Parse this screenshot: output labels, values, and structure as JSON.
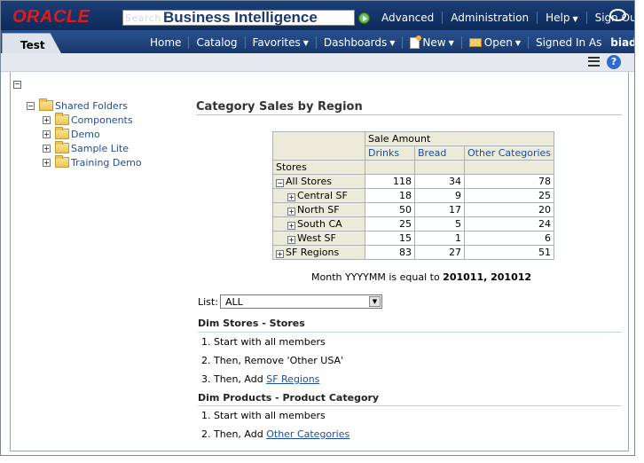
{
  "header": {
    "logo": "ORACLE",
    "search_label": "Search",
    "product_title": "Business Intelligence",
    "links": [
      {
        "label": "Advanced"
      },
      {
        "label": "Administration"
      },
      {
        "label": "Help",
        "dropdown": true
      },
      {
        "label": "Sign Out"
      }
    ]
  },
  "nav": {
    "active_tab": "Test",
    "links": [
      {
        "label": "Home"
      },
      {
        "label": "Catalog"
      },
      {
        "label": "Favorites",
        "dropdown": true
      },
      {
        "label": "Dashboards",
        "dropdown": true
      },
      {
        "label": "New",
        "dropdown": true
      },
      {
        "label": "Open",
        "dropdown": true
      }
    ],
    "signed_in_label": "Signed In As",
    "user": "biadmin"
  },
  "icons": {
    "go": "play-circle-icon",
    "chat": "chat-bubble-icon",
    "page_options": "list-icon",
    "help": "help-icon",
    "folder": "folder-icon"
  },
  "tree": {
    "collapse_symbol": "−",
    "root": "Shared Folders",
    "children": [
      "Components",
      "Demo",
      "Sample Lite",
      "Training Demo"
    ]
  },
  "report": {
    "title": "Category Sales by Region",
    "measure_header": "Sale Amount",
    "columns": [
      "Drinks",
      "Bread",
      "Other Categories"
    ],
    "row_header": "Stores",
    "rows": [
      {
        "label": "All Stores",
        "toggle": "−",
        "indent": false,
        "values": [
          "118",
          "34",
          "78"
        ]
      },
      {
        "label": "Central SF",
        "toggle": "+",
        "indent": true,
        "values": [
          "18",
          "9",
          "25"
        ]
      },
      {
        "label": "North SF",
        "toggle": "+",
        "indent": true,
        "values": [
          "50",
          "17",
          "20"
        ]
      },
      {
        "label": "South CA",
        "toggle": "+",
        "indent": true,
        "values": [
          "25",
          "5",
          "24"
        ]
      },
      {
        "label": "West SF",
        "toggle": "+",
        "indent": true,
        "values": [
          "15",
          "1",
          "6"
        ]
      },
      {
        "label": "SF Regions",
        "toggle": "+",
        "indent": false,
        "values": [
          "83",
          "27",
          "51"
        ]
      }
    ],
    "filter_text": "Month YYYYMM is equal to",
    "filter_values": "201011, 201012"
  },
  "prompt": {
    "list_label": "List:",
    "list_value": "ALL"
  },
  "selection_steps": {
    "stores": {
      "heading": "Dim Stores - Stores",
      "step1": "1. Start with all members",
      "step2": "2. Then, Remove 'Other USA'",
      "step3_prefix": "3. Then, Add",
      "step3_link": "SF Regions"
    },
    "products": {
      "heading": "Dim Products - Product Category",
      "step1": "1. Start with all members",
      "step2_prefix": "2. Then, Add",
      "step2_link": "Other Categories"
    }
  }
}
